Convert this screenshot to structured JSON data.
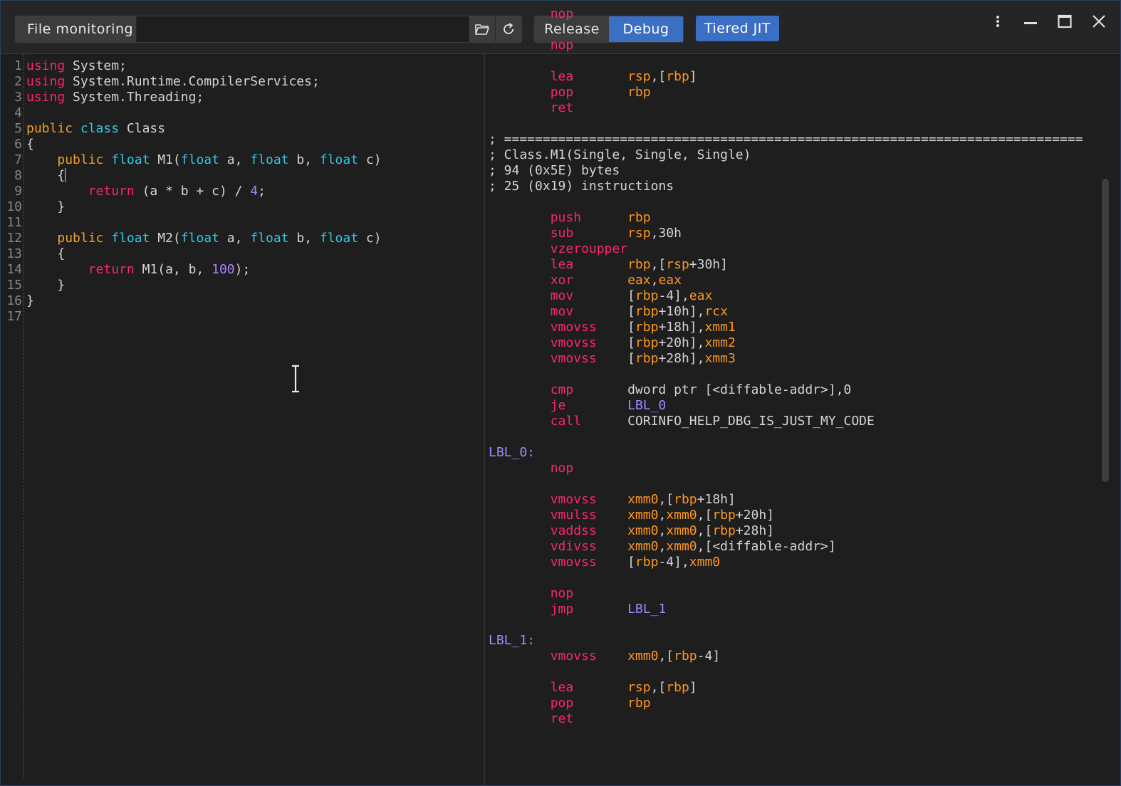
{
  "toolbar": {
    "file_monitoring_label": "File monitoring",
    "file_path_value": "",
    "open_folder_icon": "folder-open-icon",
    "refresh_icon": "refresh-icon",
    "modes": [
      {
        "label": "Release",
        "active": false
      },
      {
        "label": "Debug",
        "active": true
      }
    ],
    "tiered_jit_label": "Tiered JIT",
    "accent_color": "#3b6fc4"
  },
  "window": {
    "menu_icon": "more-vertical-icon",
    "minimize_icon": "minimize-icon",
    "maximize_icon": "maximize-icon",
    "close_icon": "close-icon"
  },
  "editor": {
    "language": "C#",
    "cursor_line": 8,
    "lines": [
      "using System;",
      "using System.Runtime.CompilerServices;",
      "using System.Threading;",
      "",
      "public class Class",
      "{",
      "    public float M1(float a, float b, float c)",
      "    {",
      "        return (a * b + c) / 4;",
      "    }",
      "",
      "    public float M2(float a, float b, float c)",
      "    {",
      "        return M1(a, b, 100);",
      "    }",
      "}",
      ""
    ]
  },
  "disassembly": {
    "lines": [
      {
        "indent": true,
        "op": "nop",
        "args": ""
      },
      {
        "indent": false,
        "op": "",
        "args": ""
      },
      {
        "indent": true,
        "op": "nop",
        "args": ""
      },
      {
        "indent": false,
        "op": "",
        "args": ""
      },
      {
        "indent": true,
        "op": "lea",
        "args": "rsp,[rbp]"
      },
      {
        "indent": true,
        "op": "pop",
        "args": "rbp"
      },
      {
        "indent": true,
        "op": "ret",
        "args": ""
      },
      {
        "indent": false,
        "op": "",
        "args": ""
      },
      {
        "comment": "; ==========================================================================="
      },
      {
        "comment": "; Class.M1(Single, Single, Single)"
      },
      {
        "comment": "; 94 (0x5E) bytes"
      },
      {
        "comment": "; 25 (0x19) instructions"
      },
      {
        "indent": false,
        "op": "",
        "args": ""
      },
      {
        "indent": true,
        "op": "push",
        "args": "rbp"
      },
      {
        "indent": true,
        "op": "sub",
        "args": "rsp,30h"
      },
      {
        "indent": true,
        "op": "vzeroupper",
        "args": ""
      },
      {
        "indent": true,
        "op": "lea",
        "args": "rbp,[rsp+30h]"
      },
      {
        "indent": true,
        "op": "xor",
        "args": "eax,eax"
      },
      {
        "indent": true,
        "op": "mov",
        "args": "[rbp-4],eax"
      },
      {
        "indent": true,
        "op": "mov",
        "args": "[rbp+10h],rcx"
      },
      {
        "indent": true,
        "op": "vmovss",
        "args": "[rbp+18h],xmm1"
      },
      {
        "indent": true,
        "op": "vmovss",
        "args": "[rbp+20h],xmm2"
      },
      {
        "indent": true,
        "op": "vmovss",
        "args": "[rbp+28h],xmm3"
      },
      {
        "indent": false,
        "op": "",
        "args": ""
      },
      {
        "indent": true,
        "op": "cmp",
        "args": "dword ptr [<diffable-addr>],0"
      },
      {
        "indent": true,
        "op": "je",
        "args": "LBL_0"
      },
      {
        "indent": true,
        "op": "call",
        "args": "CORINFO_HELP_DBG_IS_JUST_MY_CODE"
      },
      {
        "indent": false,
        "op": "",
        "args": ""
      },
      {
        "label": "LBL_0:"
      },
      {
        "indent": true,
        "op": "nop",
        "args": ""
      },
      {
        "indent": false,
        "op": "",
        "args": ""
      },
      {
        "indent": true,
        "op": "vmovss",
        "args": "xmm0,[rbp+18h]"
      },
      {
        "indent": true,
        "op": "vmulss",
        "args": "xmm0,xmm0,[rbp+20h]"
      },
      {
        "indent": true,
        "op": "vaddss",
        "args": "xmm0,xmm0,[rbp+28h]"
      },
      {
        "indent": true,
        "op": "vdivss",
        "args": "xmm0,xmm0,[<diffable-addr>]"
      },
      {
        "indent": true,
        "op": "vmovss",
        "args": "[rbp-4],xmm0"
      },
      {
        "indent": false,
        "op": "",
        "args": ""
      },
      {
        "indent": true,
        "op": "nop",
        "args": ""
      },
      {
        "indent": true,
        "op": "jmp",
        "args": "LBL_1"
      },
      {
        "indent": false,
        "op": "",
        "args": ""
      },
      {
        "label": "LBL_1:"
      },
      {
        "indent": true,
        "op": "vmovss",
        "args": "xmm0,[rbp-4]"
      },
      {
        "indent": false,
        "op": "",
        "args": ""
      },
      {
        "indent": true,
        "op": "lea",
        "args": "rsp,[rbp]"
      },
      {
        "indent": true,
        "op": "pop",
        "args": "rbp"
      },
      {
        "indent": true,
        "op": "ret",
        "args": ""
      }
    ]
  }
}
